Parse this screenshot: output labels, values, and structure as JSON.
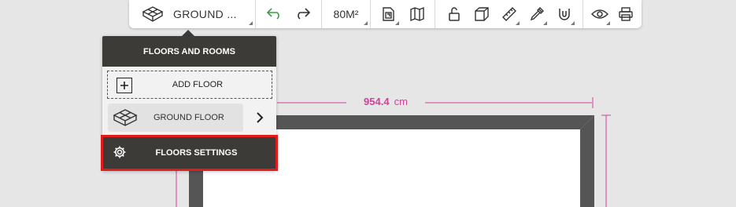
{
  "toolbar": {
    "floor_selector": {
      "label": "GROUND ...",
      "icon": "floor-box-icon"
    },
    "undo_icon": "undo-icon",
    "redo_icon": "redo-icon",
    "area_label": "80M²",
    "icons": [
      "floor-plan-icon",
      "map-icon",
      "lock-icon",
      "cube-3d-icon",
      "ruler-icon",
      "pipette-icon",
      "magnet-icon",
      "eye-icon",
      "print-icon"
    ],
    "undo_color": "#3f9a4a"
  },
  "dropdown": {
    "title": "FLOORS AND ROOMS",
    "add_floor_label": "ADD FLOOR",
    "floor_item_label": "GROUND FLOOR",
    "settings_label": "FLOORS SETTINGS",
    "highlight_color": "#e21b1b",
    "header_color": "#3d3b38"
  },
  "plan": {
    "dimension_value": "954.4",
    "dimension_unit": "cm",
    "dimension_color": "#d63d9f",
    "wall_color": "#555555"
  }
}
